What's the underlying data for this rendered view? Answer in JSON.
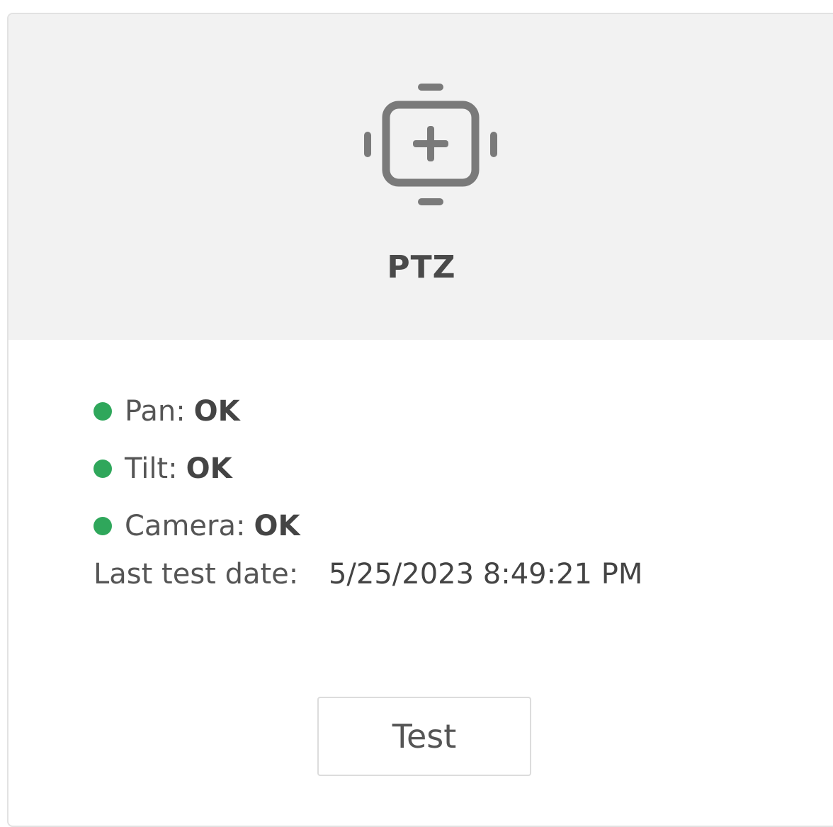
{
  "card": {
    "title": "PTZ",
    "icon": "ptz-crosshair-icon",
    "status_items": [
      {
        "label": "Pan:",
        "value": "OK",
        "status_color": "#2fa75b"
      },
      {
        "label": "Tilt:",
        "value": "OK",
        "status_color": "#2fa75b"
      },
      {
        "label": "Camera:",
        "value": "OK",
        "status_color": "#2fa75b"
      }
    ],
    "last_test_label": "Last test date:",
    "last_test_value": "5/25/2023 8:49:21 PM",
    "test_button_label": "Test"
  }
}
